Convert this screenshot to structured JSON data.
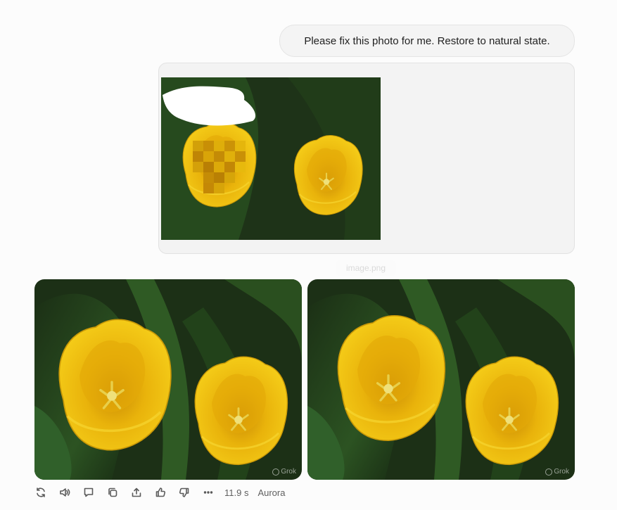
{
  "conversation": {
    "user_message": "Please fix this photo for me. Restore to natural state.",
    "attachment": {
      "filename": "image.png",
      "alt": "yellow tulips"
    }
  },
  "response": {
    "images": [
      {
        "alt": "restored tulips option 1",
        "watermark": "Grok"
      },
      {
        "alt": "restored tulips option 2",
        "watermark": "Grok"
      }
    ],
    "toolbar": {
      "icons": [
        "regenerate-icon",
        "read-aloud-icon",
        "comment-icon",
        "copy-icon",
        "share-icon",
        "thumbs-up-icon",
        "thumbs-down-icon",
        "more-icon"
      ],
      "duration": "11.9 s",
      "model": "Aurora"
    }
  },
  "colors": {
    "petal": "#f2c40c",
    "petal_shadow": "#d49a06",
    "foliage": "#24401c",
    "background": "#fcfcfc"
  }
}
